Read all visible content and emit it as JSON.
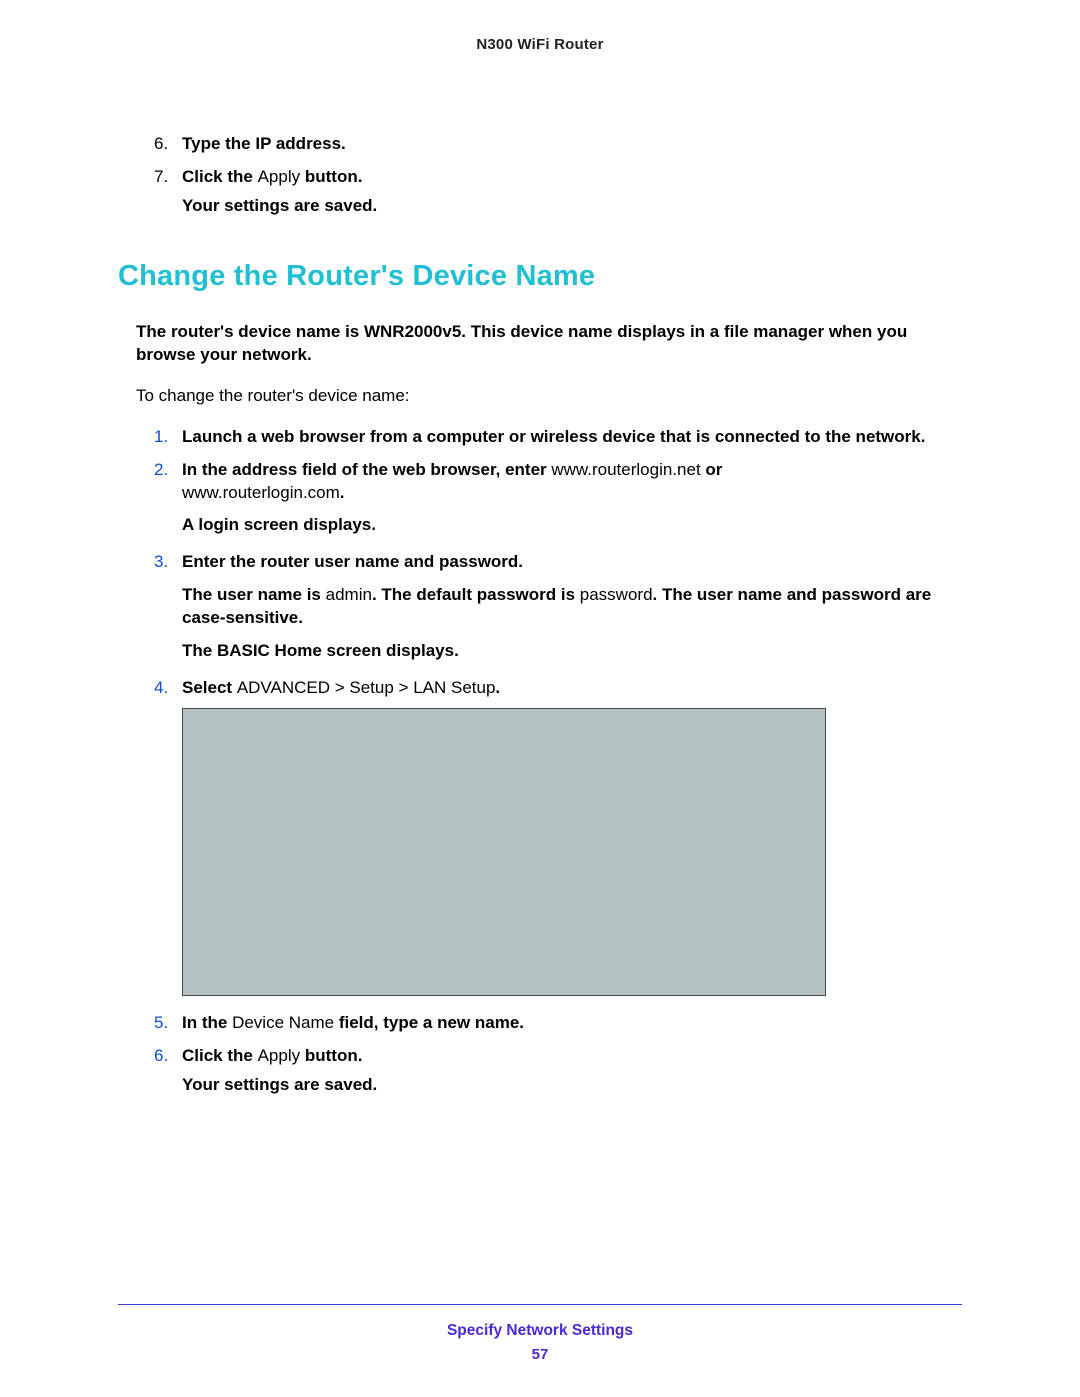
{
  "header": {
    "product": "N300 WiFi Router"
  },
  "top_steps": [
    {
      "num": "6.",
      "body": "Type the IP address."
    },
    {
      "num": "7.",
      "body_prefix": "Click the ",
      "body_plain": "Apply",
      "body_suffix": " button.",
      "after": "Your settings are saved."
    }
  ],
  "section": {
    "title": "Change the Router's Device Name",
    "intro_bold_prefix": "The router's",
    "intro_bold_mid": " device name is WNR2000v5. This device name displays in a file manager when you browse your network.",
    "lead": "To change the router's device name:"
  },
  "steps": {
    "s1": {
      "num": "1.",
      "text": "Launch a web browser from a computer or wireless device that is connected to the network."
    },
    "s2": {
      "num": "2.",
      "pre_bold": "In the address field of the web browser, enter ",
      "url1": "www.routerlogin.net",
      "or": "   or ",
      "url2": "www.routerlogin.com",
      "period": ".",
      "after": "A login screen displays."
    },
    "s3": {
      "num": "3.",
      "line1": "Enter the router user name and password.",
      "l2_pre": "The user name is ",
      "l2_admin": "admin",
      "l2_mid": ". The default password is ",
      "l2_pwd": "password",
      "l2_suf": ". The user name and password are case-sensitive.",
      "l3": "The BASIC Home screen displays."
    },
    "s4": {
      "num": "4.",
      "pre": "Select ",
      "path": "ADVANCED > Setup > LAN Setup",
      "suf": "."
    },
    "s5": {
      "num": "5.",
      "pre": "In the ",
      "mid": "Device Name",
      "suf": " field, type a new name."
    },
    "s6": {
      "num": "6.",
      "pre": "Click the ",
      "plain": "Apply",
      "suf": " button.",
      "after": "Your settings are saved."
    }
  },
  "footer": {
    "chapter": "Specify Network Settings",
    "page": "57"
  }
}
